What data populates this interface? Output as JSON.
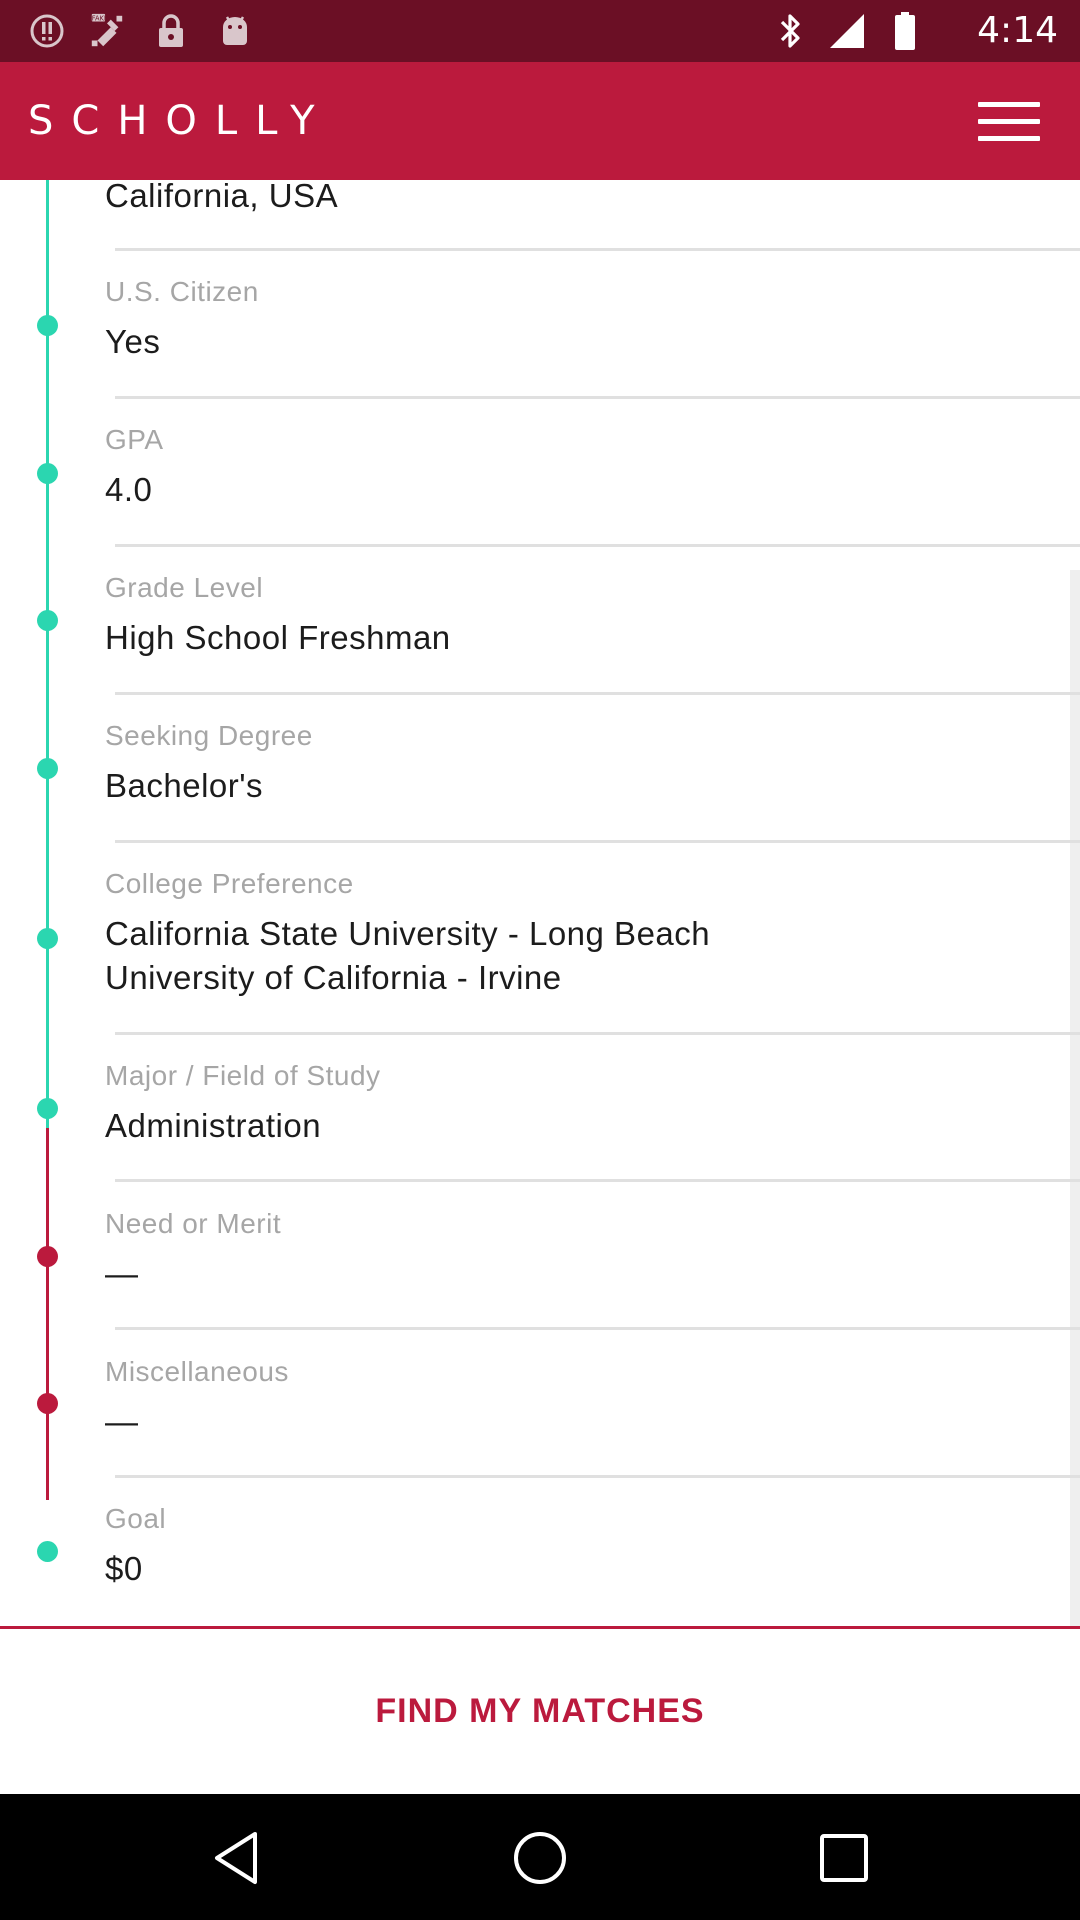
{
  "status_bar": {
    "time": "4:14",
    "left_icons": [
      "alert-icon",
      "fake-gps-icon",
      "lock-icon",
      "android-icon"
    ],
    "right_icons": [
      "bluetooth-icon",
      "signal-icon",
      "battery-icon"
    ]
  },
  "app_bar": {
    "title": "SCHOLLY",
    "menu_icon": "hamburger-menu-icon"
  },
  "colors": {
    "primary": "#bb1a3d",
    "status_bar": "#6b0f25",
    "complete_dot": "#2bd6b0",
    "incomplete_dot": "#bb1a3d",
    "label": "#a6a6a6",
    "value": "#1c1c1c"
  },
  "profile": {
    "rows": [
      {
        "label": "",
        "value": "California, USA",
        "complete": true
      },
      {
        "label": "U.S. Citizen",
        "value": "Yes",
        "complete": true
      },
      {
        "label": "GPA",
        "value": "4.0",
        "complete": true
      },
      {
        "label": "Grade Level",
        "value": "High School Freshman",
        "complete": true
      },
      {
        "label": "Seeking Degree",
        "value": "Bachelor's",
        "complete": true
      },
      {
        "label": "College Preference",
        "value": "California State University - Long Beach",
        "value2": "University of California - Irvine",
        "complete": true
      },
      {
        "label": "Major / Field of Study",
        "value": "Administration",
        "complete": true
      },
      {
        "label": "Need or Merit",
        "value": "—",
        "complete": false
      },
      {
        "label": "Miscellaneous",
        "value": "—",
        "complete": false
      },
      {
        "label": "Goal",
        "value": "$0",
        "complete": true
      }
    ]
  },
  "action": {
    "find_label": "FIND MY MATCHES"
  },
  "nav_bar": {
    "icons": [
      "back-icon",
      "home-icon",
      "recents-icon"
    ]
  }
}
